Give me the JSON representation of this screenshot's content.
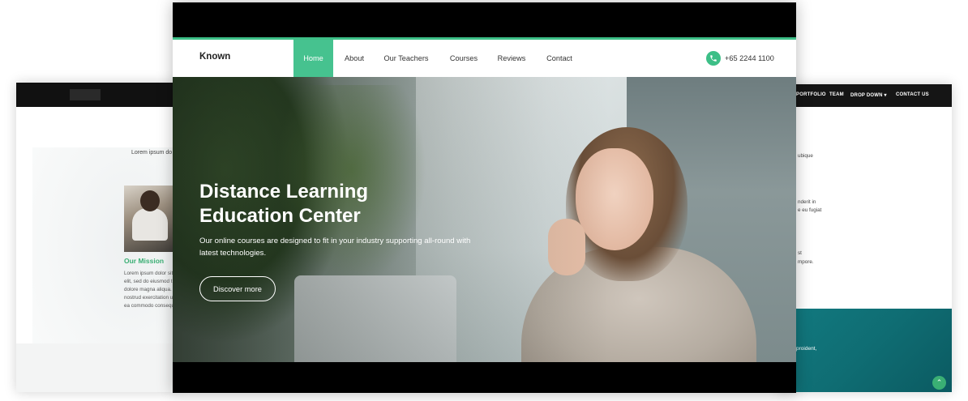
{
  "left_mock": {
    "lorem_top": "Lorem ipsum do",
    "mission_title": "Our Mission",
    "mission_lines": [
      "Lorem ipsum dolor sit",
      "elit, sed do eiusmod t",
      "dolore magna aliqua.",
      "nostrud exercitation u",
      "ea commodo consequ"
    ]
  },
  "right_mock": {
    "nav": [
      "PORTFOLIO",
      "TEAM",
      "DROP DOWN ▾",
      "CONTACT US"
    ],
    "snippets": [
      "ubique",
      "nderit in",
      "e eu fugiat",
      "st",
      "mpore.",
      "proident,"
    ]
  },
  "main": {
    "brand": "Known",
    "nav": [
      {
        "label": "Home",
        "active": true
      },
      {
        "label": "About",
        "active": false
      },
      {
        "label": "Our Teachers",
        "active": false
      },
      {
        "label": "Courses",
        "active": false
      },
      {
        "label": "Reviews",
        "active": false
      },
      {
        "label": "Contact",
        "active": false
      }
    ],
    "phone": "+65 2244 1100",
    "hero": {
      "title_line1": "Distance Learning",
      "title_line2": "Education Center",
      "subtitle": "Our online courses are designed to fit in your industry supporting all-round with latest technologies.",
      "button": "Discover more"
    }
  },
  "colors": {
    "accent": "#46c28f",
    "mission_title": "#3aaf74",
    "teal_band": "#0f6d73"
  },
  "icons": {
    "phone": "phone-icon",
    "back_to_top": "chevron-up-icon"
  }
}
